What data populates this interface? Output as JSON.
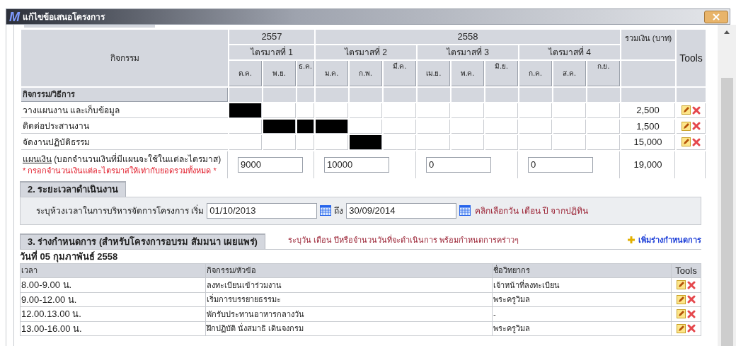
{
  "window": {
    "logo": "M",
    "title": "แก้ไขข้อเสนอโครงการ"
  },
  "plan": {
    "activity_header": "กิจกรรม",
    "total_header": "รวมเงิน (บาท)",
    "tools_header": "Tools",
    "section_label": "กิจกรรม/วิธีการ",
    "years": [
      {
        "label": "2557",
        "quarters": [
          {
            "label": "ไตรมาสที่ 1",
            "months": [
              "ต.ค.",
              "พ.ย.",
              "ธ.ค."
            ]
          }
        ]
      },
      {
        "label": "2558",
        "quarters": [
          {
            "label": "ไตรมาสที่ 2",
            "months": [
              "ม.ค.",
              "ก.พ.",
              "มี.ค."
            ]
          },
          {
            "label": "ไตรมาสที่ 3",
            "months": [
              "เม.ย.",
              "พ.ค.",
              "มิ.ย."
            ]
          },
          {
            "label": "ไตรมาสที่ 4",
            "months": [
              "ก.ค.",
              "ส.ค.",
              "ก.ย."
            ]
          }
        ]
      }
    ],
    "activities": [
      {
        "name": "วางแผนงาน และเก็บข้อมูล",
        "active": [
          true,
          false,
          false,
          false,
          false,
          false,
          false,
          false,
          false,
          false,
          false,
          false
        ],
        "total": "2,500"
      },
      {
        "name": "ติดต่อประสานงาน",
        "active": [
          false,
          true,
          true,
          true,
          false,
          false,
          false,
          false,
          false,
          false,
          false,
          false
        ],
        "total": "1,500"
      },
      {
        "name": "จัดงานปฏิบัติธรรม",
        "active": [
          false,
          false,
          false,
          false,
          true,
          false,
          false,
          false,
          false,
          false,
          false,
          false
        ],
        "total": "15,000"
      }
    ],
    "budget": {
      "label": "แผนเงิน",
      "hint": "(บอกจำนวนเงินที่มีแผนจะใช้ในแต่ละไตรมาส)",
      "warning": "* กรอกจำนวนเงินแต่ละไตรมาสให้เท่ากับยอดรวมทั้งหมด *",
      "amounts": [
        "9000",
        "10000",
        "0",
        "0"
      ],
      "total": "19,000"
    }
  },
  "period": {
    "title": "2. ระยะเวลาดำเนินงาน",
    "label": "ระบุห้วงเวลาในการบริหารจัดการโครงการ เริ่ม",
    "start": "01/10/2013",
    "to_label": "ถึง",
    "end": "30/09/2014",
    "hint": "คลิกเลือกวัน เดือน ปี จากปฏิทิน"
  },
  "schedule": {
    "title": "3. ร่างกำหนดการ (สำหรับโครงการอบรม สัมมนา เผยแพร่)",
    "hint": "ระบุวัน เดือน ปีหรือจำนวนวันที่จะดำเนินการ พร้อมกำหนดการคร่าวๆ",
    "add_link": "เพิ่มร่างกำหนดการ",
    "day": "วันที่ 05 กุมภาพันธ์ 2558",
    "columns": [
      "เวลา",
      "กิจกรรม/หัวข้อ",
      "ชื่อวิทยากร",
      "Tools"
    ],
    "rows": [
      {
        "time": "8.00-9.00 น.",
        "topic": "ลงทะเบียนเข้าร่วมงาน",
        "speaker": "เจ้าหน้าที่ลงทะเบียน"
      },
      {
        "time": "9.00-12.00 น.",
        "topic": "เริ่มการบรรยายธรรมะ",
        "speaker": "พระครูวิมล"
      },
      {
        "time": "12.00.13.00 น.",
        "topic": "พักรับประทานอาหารกลางวัน",
        "speaker": "-"
      },
      {
        "time": "13.00-16.00 น.",
        "topic": "ฝึกปฏิบัติ นั่งสมาธิ เดินจงกรม",
        "speaker": "พระครูวิมล"
      }
    ]
  }
}
